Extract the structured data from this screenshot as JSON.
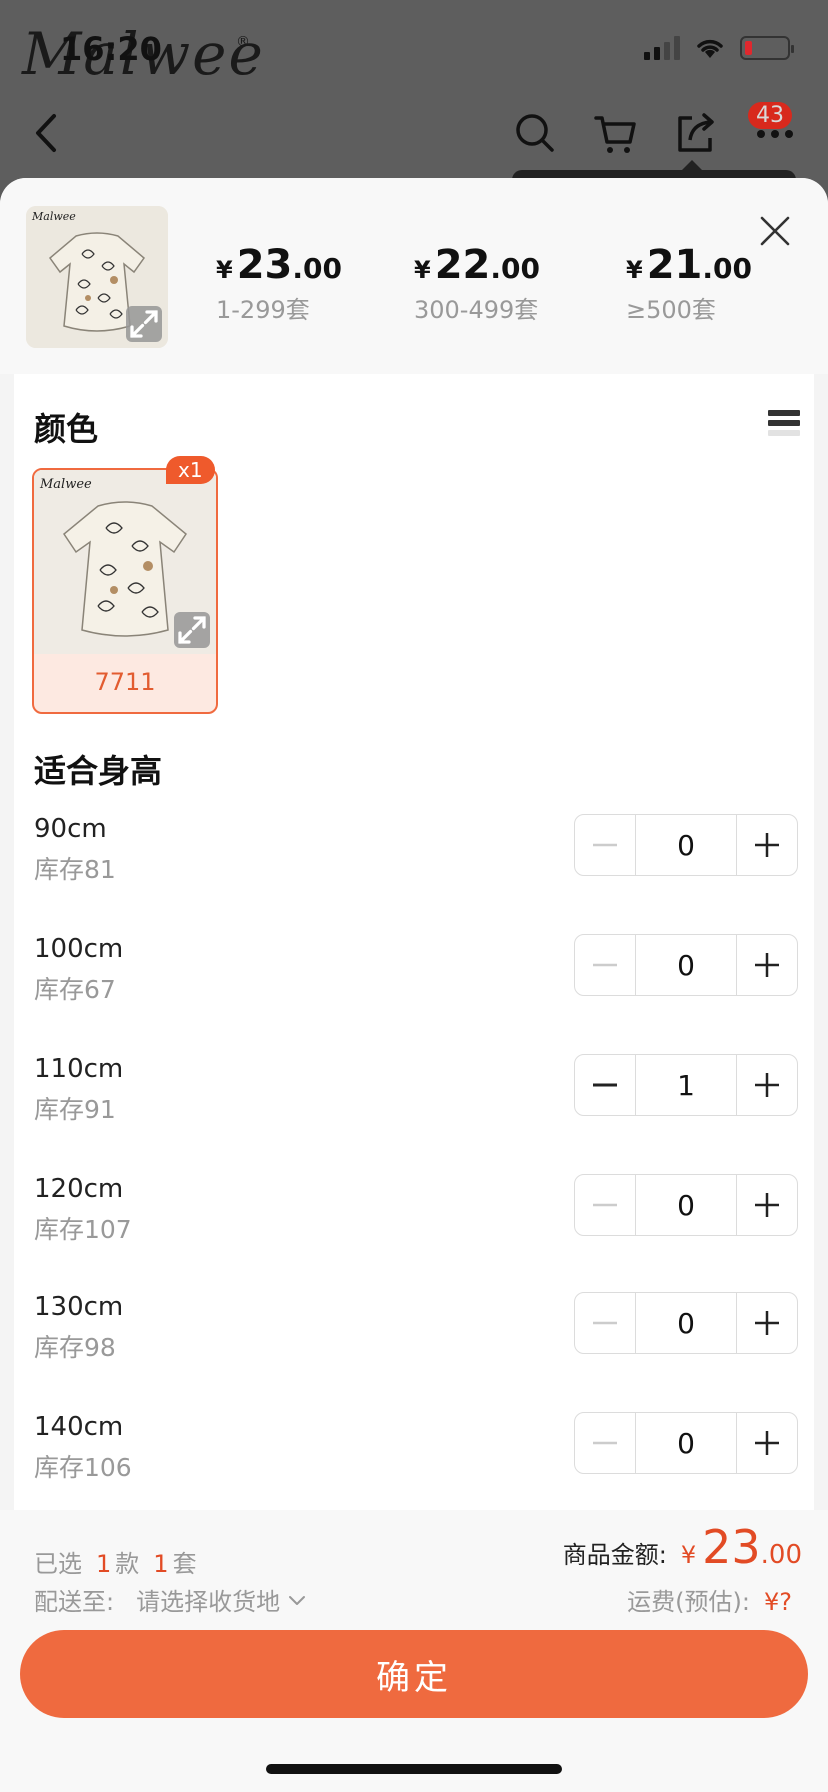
{
  "status_bar": {
    "time": "16:20"
  },
  "background_page": {
    "brand": "Malwee",
    "brand_mark": "®",
    "cart_badge": "43"
  },
  "sheet": {
    "price_tiers": [
      {
        "currency": "¥",
        "price_int": "23",
        "price_dec": ".00",
        "range": "1-299套"
      },
      {
        "currency": "¥",
        "price_int": "22",
        "price_dec": ".00",
        "range": "300-499套"
      },
      {
        "currency": "¥",
        "price_int": "21",
        "price_dec": ".00",
        "range": "≥500套"
      }
    ],
    "color_section": {
      "title": "颜色",
      "options": [
        {
          "name": "7711",
          "selected_count": "x1"
        }
      ]
    },
    "size_section": {
      "title": "适合身高",
      "rows": [
        {
          "size": "90cm",
          "stock": "库存81",
          "qty": "0"
        },
        {
          "size": "100cm",
          "stock": "库存67",
          "qty": "0"
        },
        {
          "size": "110cm",
          "stock": "库存91",
          "qty": "1"
        },
        {
          "size": "120cm",
          "stock": "库存107",
          "qty": "0"
        },
        {
          "size": "130cm",
          "stock": "库存98",
          "qty": "0"
        },
        {
          "size": "140cm",
          "stock": "库存106",
          "qty": "0"
        }
      ]
    },
    "footer": {
      "selected_prefix": "已选",
      "selected_styles": "1",
      "styles_unit": "款",
      "selected_sets": "1",
      "sets_unit": "套",
      "ship_label": "配送至:",
      "ship_placeholder": "请选择收货地",
      "total_label": "商品金额:",
      "total_currency": "¥",
      "total_int": "23",
      "total_dec": ".00",
      "freight_label": "运费(预估):",
      "freight_value": "¥?",
      "confirm_label": "确定"
    }
  },
  "colors": {
    "accent": "#ef6a3f",
    "accent_text": "#e24b25",
    "muted": "#999999"
  }
}
